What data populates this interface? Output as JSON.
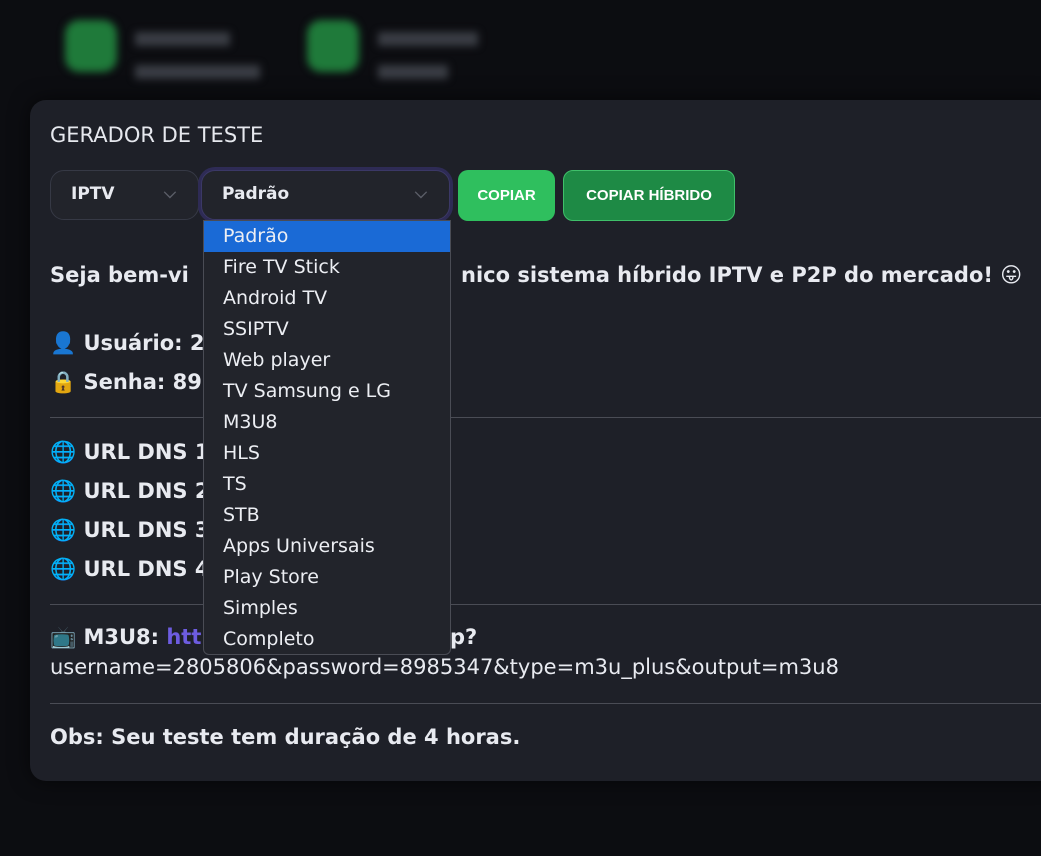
{
  "header_blurred": true,
  "modal": {
    "title": "GERADOR DE TESTE",
    "type_select": {
      "value": "IPTV"
    },
    "format_select": {
      "value": "Padrão",
      "options": [
        "Padrão",
        "Fire TV Stick",
        "Android TV",
        "SSIPTV",
        "Web player",
        "TV Samsung e LG",
        "M3U8",
        "HLS",
        "TS",
        "STB",
        "Apps Universais",
        "Play Store",
        "Simples",
        "Completo"
      ],
      "selected_index": 0
    },
    "copy_label": "COPIAR",
    "copy_hybrid_label": "COPIAR HÍBRIDO",
    "welcome_start": "Seja bem-vi",
    "welcome_end": "nico sistema híbrido IPTV e P2P do mercado! 😛",
    "user_visible": "Usuário: 2",
    "pass_visible": "Senha: 89",
    "dns": [
      "URL DNS 1",
      "URL DNS 2",
      "URL DNS 3",
      "URL DNS 4"
    ],
    "m3u8_label": "M3U8:",
    "m3u8_link_start": "htt",
    "m3u8_link_mid": "p?",
    "m3u8_link_line2": "username=2805806&password=8985347&type=m3u_plus&output=m3u8",
    "obs": "Obs: Seu teste tem duração de 4 horas."
  },
  "colors": {
    "accent_green": "#2fbf5e",
    "dark_green": "#1e8a45",
    "link": "#6d5ce0",
    "selected": "#1a6ad6"
  }
}
